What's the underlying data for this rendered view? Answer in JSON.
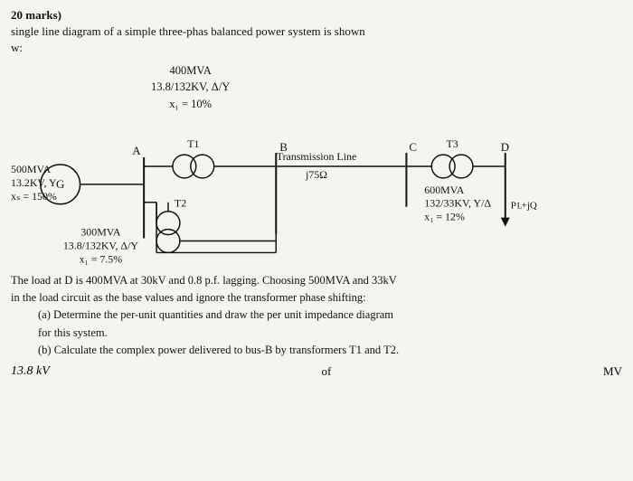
{
  "header": {
    "marks_label": "20 marks)",
    "intro_text": "single line diagram of a simple three-phas balanced power system is shown",
    "intro_cont": "w:"
  },
  "t1": {
    "rating": "400MVA",
    "voltage": "13.8/132KV, Δ/Y",
    "reactance": "x₁ = 10%",
    "label": "T1"
  },
  "t2": {
    "rating": "300MVA",
    "voltage": "13.8/132KV, Δ/Y",
    "reactance": "x₁ = 7.5%",
    "label": "T2"
  },
  "t3": {
    "rating": "600MVA",
    "voltage": "132/33KV, Y/Δ",
    "reactance": "x₁ = 12%",
    "load_suffix": "▼PL + jQ",
    "label": "T3"
  },
  "generator": {
    "label": "G",
    "rating": "500MVA",
    "voltage": "13.2KV, Y",
    "reactance": "xₛ = 150%"
  },
  "transmission": {
    "label": "Transmission Line",
    "impedance": "j75Ω"
  },
  "nodes": {
    "a": "A",
    "b": "B",
    "c": "C",
    "d": "D"
  },
  "problem": {
    "intro": "The load at D is 400MVA at 30kV and 0.8 p.f. lagging. Choosing 500MVA and 33kV",
    "intro2": "in the load circuit as the base values and ignore the transformer phase shifting:",
    "part_a": "(a) Determine the per-unit quantities and draw the per unit impedance diagram",
    "part_a2": "for this system.",
    "part_b": "(b) Calculate the complex power delivered to bus-B by transformers T1 and T2."
  },
  "footer": {
    "left": "13.8 kV",
    "of_text": "of",
    "right": "MV"
  },
  "colors": {
    "line": "#111111",
    "background": "#f5f5f0"
  }
}
